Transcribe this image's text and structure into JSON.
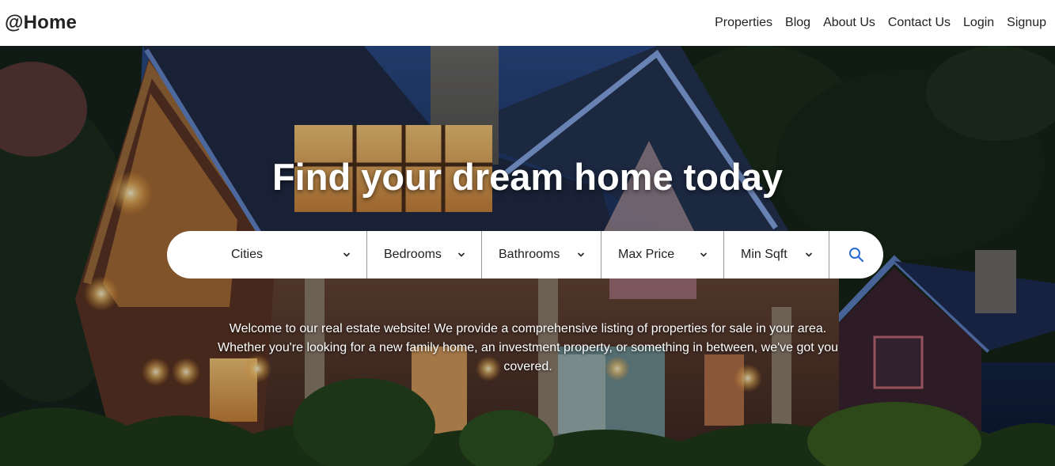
{
  "header": {
    "logo": "@Home",
    "nav": [
      "Properties",
      "Blog",
      "About Us",
      "Contact Us",
      "Login",
      "Signup"
    ]
  },
  "hero": {
    "title": "Find your dream home today",
    "description": "Welcome to our real estate website! We provide a comprehensive listing of properties for sale in your area. Whether you're looking for a new family home, an investment property, or something in between, we've got you covered."
  },
  "search": {
    "filters": [
      "Cities",
      "Bedrooms",
      "Bathrooms",
      "Max Price",
      "Min Sqft"
    ],
    "button_icon": "search-icon"
  },
  "colors": {
    "accent": "#2a6ad8",
    "header_bg": "#ffffff",
    "text": "#222222"
  }
}
